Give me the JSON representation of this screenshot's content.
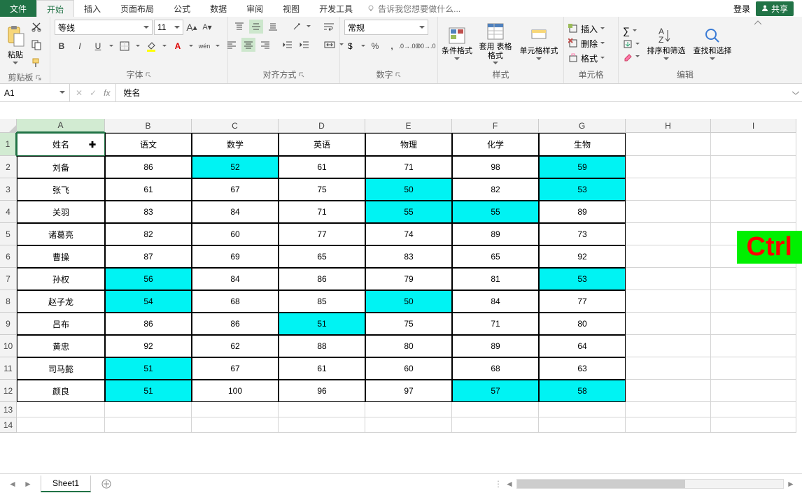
{
  "menu": {
    "file": "文件",
    "home": "开始",
    "insert": "插入",
    "layout": "页面布局",
    "formulas": "公式",
    "data": "数据",
    "review": "审阅",
    "view": "视图",
    "dev": "开发工具",
    "tellme": "告诉我您想要做什么...",
    "login": "登录",
    "share": "共享"
  },
  "ribbon": {
    "clipboard": {
      "label": "剪贴板",
      "paste": "粘贴"
    },
    "font": {
      "label": "字体",
      "name": "等线",
      "size": "11"
    },
    "align": {
      "label": "对齐方式"
    },
    "number": {
      "label": "数字",
      "format": "常规"
    },
    "styles": {
      "label": "样式",
      "cond": "条件格式",
      "tblfmt": "套用\n表格格式",
      "cellstyle": "单元格样式"
    },
    "cells": {
      "label": "单元格",
      "insert": "插入",
      "delete": "删除",
      "format": "格式"
    },
    "editing": {
      "label": "编辑",
      "sort": "排序和筛选",
      "find": "查找和选择"
    }
  },
  "formula_bar": {
    "name": "A1",
    "value": "姓名"
  },
  "grid": {
    "columns": [
      "A",
      "B",
      "C",
      "D",
      "E",
      "F",
      "G",
      "H",
      "I"
    ],
    "row_heights": {
      "header": 33,
      "data": 32,
      "blank": 22
    },
    "active_cell": "A1",
    "highlight_color": "#00f3f3",
    "rows": [
      {
        "r": 1,
        "header": true,
        "cells": [
          "姓名",
          "语文",
          "数学",
          "英语",
          "物理",
          "化学",
          "生物"
        ]
      },
      {
        "r": 2,
        "cells": [
          "刘备",
          "86",
          "52",
          "61",
          "71",
          "98",
          "59"
        ],
        "hl": [
          2,
          6
        ]
      },
      {
        "r": 3,
        "cells": [
          "张飞",
          "61",
          "67",
          "75",
          "50",
          "82",
          "53"
        ],
        "hl": [
          4,
          6
        ]
      },
      {
        "r": 4,
        "cells": [
          "关羽",
          "83",
          "84",
          "71",
          "55",
          "55",
          "89"
        ],
        "hl": [
          4,
          5
        ]
      },
      {
        "r": 5,
        "cells": [
          "诸葛亮",
          "82",
          "60",
          "77",
          "74",
          "89",
          "73"
        ],
        "hl": []
      },
      {
        "r": 6,
        "cells": [
          "曹操",
          "87",
          "69",
          "65",
          "83",
          "65",
          "92"
        ],
        "hl": []
      },
      {
        "r": 7,
        "cells": [
          "孙权",
          "56",
          "84",
          "86",
          "79",
          "81",
          "53"
        ],
        "hl": [
          1,
          6
        ]
      },
      {
        "r": 8,
        "cells": [
          "赵子龙",
          "54",
          "68",
          "85",
          "50",
          "84",
          "77"
        ],
        "hl": [
          1,
          4
        ]
      },
      {
        "r": 9,
        "cells": [
          "吕布",
          "86",
          "86",
          "51",
          "75",
          "71",
          "80"
        ],
        "hl": [
          3
        ]
      },
      {
        "r": 10,
        "cells": [
          "黄忠",
          "92",
          "62",
          "88",
          "80",
          "89",
          "64"
        ],
        "hl": []
      },
      {
        "r": 11,
        "cells": [
          "司马懿",
          "51",
          "67",
          "61",
          "60",
          "68",
          "63"
        ],
        "hl": [
          1
        ]
      },
      {
        "r": 12,
        "cells": [
          "颜良",
          "51",
          "100",
          "96",
          "97",
          "57",
          "58"
        ],
        "hl": [
          1,
          5,
          6
        ]
      }
    ],
    "blank_rows": [
      13,
      14
    ]
  },
  "sheet": {
    "active": "Sheet1"
  },
  "badge": "Ctrl"
}
